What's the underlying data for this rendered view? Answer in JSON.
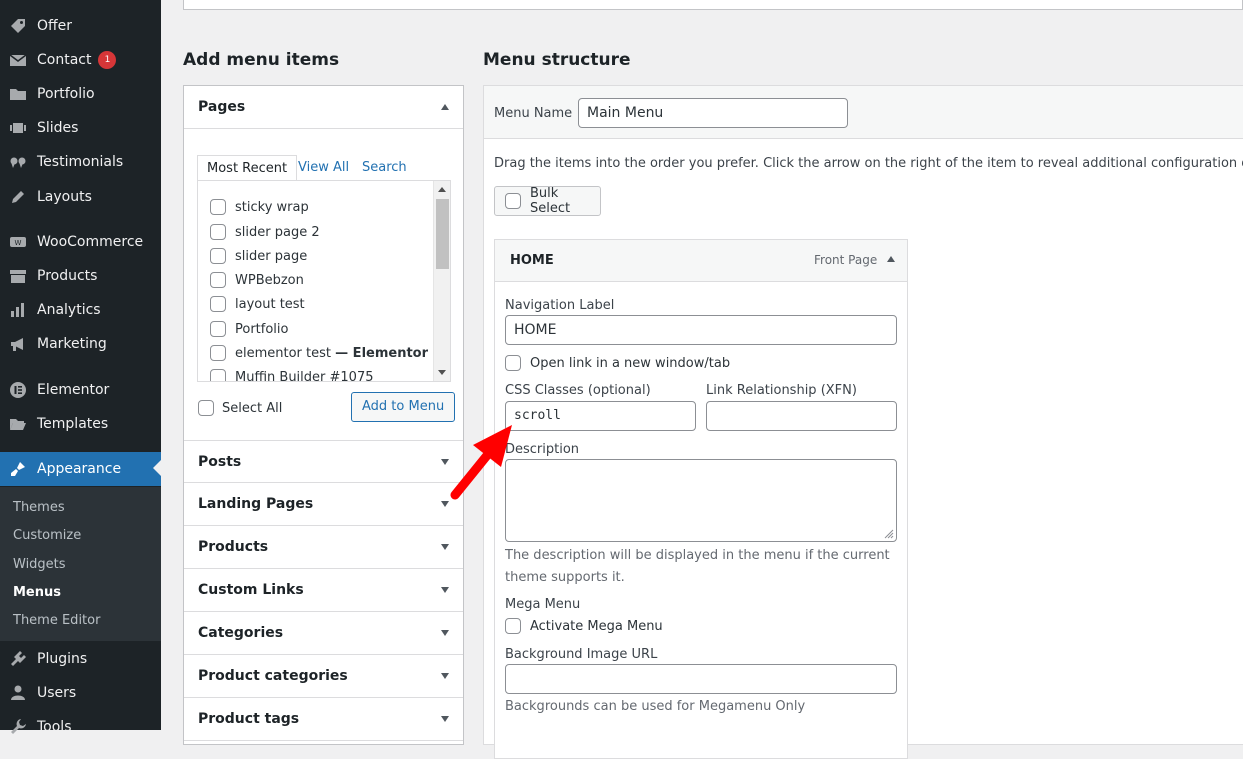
{
  "sidebar": {
    "items": [
      {
        "label": "Offer",
        "icon": "tag-icon"
      },
      {
        "label": "Contact",
        "icon": "mail-icon",
        "badge": "1"
      },
      {
        "label": "Portfolio",
        "icon": "folder-icon"
      },
      {
        "label": "Slides",
        "icon": "slides-icon"
      },
      {
        "label": "Testimonials",
        "icon": "quote-icon"
      },
      {
        "label": "Layouts",
        "icon": "pencil-icon"
      },
      {
        "label": "WooCommerce",
        "icon": "woo-icon"
      },
      {
        "label": "Products",
        "icon": "archive-icon"
      },
      {
        "label": "Analytics",
        "icon": "bar-chart-icon"
      },
      {
        "label": "Marketing",
        "icon": "megaphone-icon"
      },
      {
        "label": "Elementor",
        "icon": "elementor-icon"
      },
      {
        "label": "Templates",
        "icon": "folder-open-icon"
      },
      {
        "label": "Appearance",
        "icon": "brush-icon"
      },
      {
        "label": "Plugins",
        "icon": "plugin-icon"
      },
      {
        "label": "Users",
        "icon": "user-icon"
      },
      {
        "label": "Tools",
        "icon": "wrench-icon"
      }
    ],
    "submenu": [
      "Themes",
      "Customize",
      "Widgets",
      "Menus",
      "Theme Editor"
    ]
  },
  "left": {
    "title": "Add menu items",
    "pages_title": "Pages",
    "tabs": [
      "Most Recent",
      "View All",
      "Search"
    ],
    "pages": [
      "sticky wrap",
      "slider page 2",
      "slider page",
      "WPBebzon",
      "layout test",
      "Portfolio",
      "elementor test",
      "Muffin Builder #1075"
    ],
    "page_suffix": "— Elementor",
    "select_all": "Select All",
    "add_to_menu": "Add to Menu",
    "sections": [
      "Posts",
      "Landing Pages",
      "Products",
      "Custom Links",
      "Categories",
      "Product categories",
      "Product tags"
    ]
  },
  "right": {
    "title": "Menu structure",
    "menu_name_label": "Menu Name",
    "menu_name_value": "Main Menu",
    "instructions": "Drag the items into the order you prefer. Click the arrow on the right of the item to reveal additional configuration options.",
    "bulk_select": "Bulk Select",
    "item": {
      "title": "HOME",
      "type": "Front Page",
      "nav_label_label": "Navigation Label",
      "nav_label_value": "HOME",
      "new_tab_label": "Open link in a new window/tab",
      "css_label": "CSS Classes (optional)",
      "css_value": "scroll",
      "xfn_label": "Link Relationship (XFN)",
      "xfn_value": "",
      "desc_label": "Description",
      "desc_hint": "The description will be displayed in the menu if the current theme supports it.",
      "mega_label": "Mega Menu",
      "mega_check": "Activate Mega Menu",
      "bg_label": "Background Image URL",
      "bg_value": "",
      "bg_hint": "Backgrounds can be used for Megamenu Only"
    }
  },
  "colors": {
    "accent": "#2271b1",
    "sidebar_bg": "#1d2327",
    "badge": "#d63638",
    "arrow": "#ff0000"
  }
}
